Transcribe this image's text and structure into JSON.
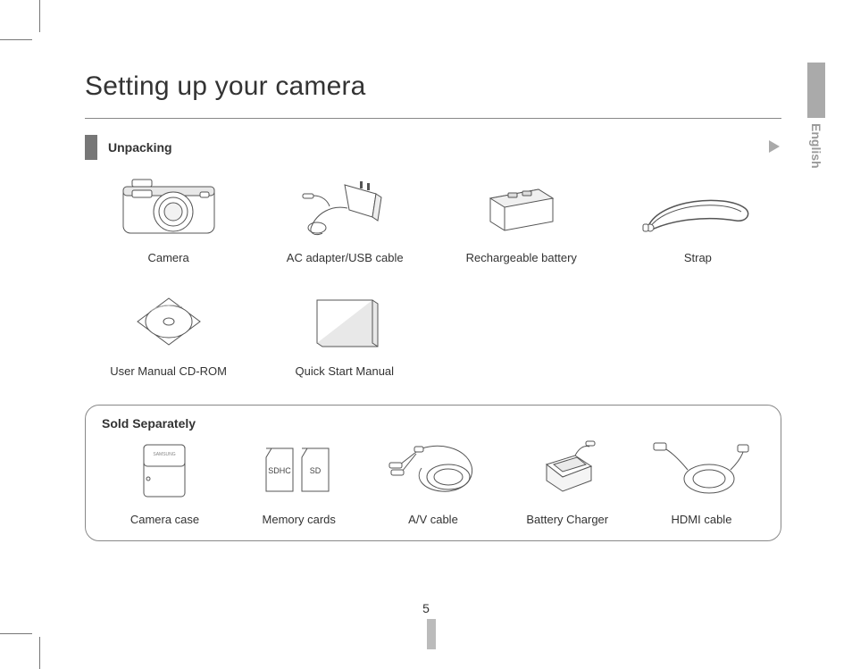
{
  "title": "Setting up your camera",
  "section": "Unpacking",
  "language_tab": "English",
  "page_number": "5",
  "included": [
    {
      "label": "Camera"
    },
    {
      "label": "AC adapter/USB cable"
    },
    {
      "label": "Rechargeable battery"
    },
    {
      "label": "Strap"
    },
    {
      "label": "User Manual CD-ROM"
    },
    {
      "label": "Quick Start Manual"
    }
  ],
  "sold_separately_title": "Sold Separately",
  "sold_separately": [
    {
      "label": "Camera case"
    },
    {
      "label": "Memory cards",
      "card_text_1": "SDHC",
      "card_text_2": "SD"
    },
    {
      "label": "A/V cable"
    },
    {
      "label": "Battery Charger"
    },
    {
      "label": "HDMI cable"
    }
  ]
}
